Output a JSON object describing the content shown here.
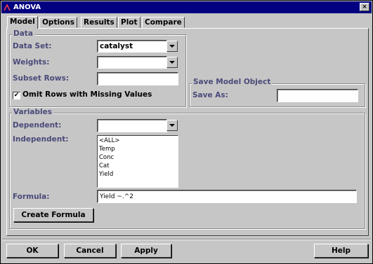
{
  "window": {
    "title": "ANOVA",
    "close_glyph": "×"
  },
  "tabs": [
    {
      "label": "Model",
      "active": true
    },
    {
      "label": "Options",
      "active": false
    },
    {
      "label": "Results",
      "active": false
    },
    {
      "label": "Plot",
      "active": false
    },
    {
      "label": "Compare",
      "active": false
    }
  ],
  "data_group": {
    "title": "Data",
    "data_set_label": "Data Set:",
    "data_set_value": "catalyst",
    "weights_label": "Weights:",
    "weights_value": "",
    "subset_label": "Subset Rows:",
    "subset_value": "",
    "omit_label": "Omit Rows with Missing Values",
    "omit_checked": true,
    "omit_glyph": "✔"
  },
  "save_group": {
    "title": "Save Model Object",
    "save_as_label": "Save As:",
    "save_as_value": ""
  },
  "variables_group": {
    "title": "Variables",
    "dependent_label": "Dependent:",
    "dependent_value": "",
    "independent_label": "Independent:",
    "independent_items": [
      "<ALL>",
      "Temp",
      "Conc",
      "Cat",
      "Yield"
    ],
    "formula_label": "Formula:",
    "formula_value": "Yield ~.^2",
    "create_formula_label": "Create Formula"
  },
  "buttons": {
    "ok": "OK",
    "cancel": "Cancel",
    "apply": "Apply",
    "help": "Help"
  },
  "colors": {
    "title_bar": "#000080",
    "label_text": "#4a4a7a",
    "panel_bg": "#c6c6c6"
  }
}
